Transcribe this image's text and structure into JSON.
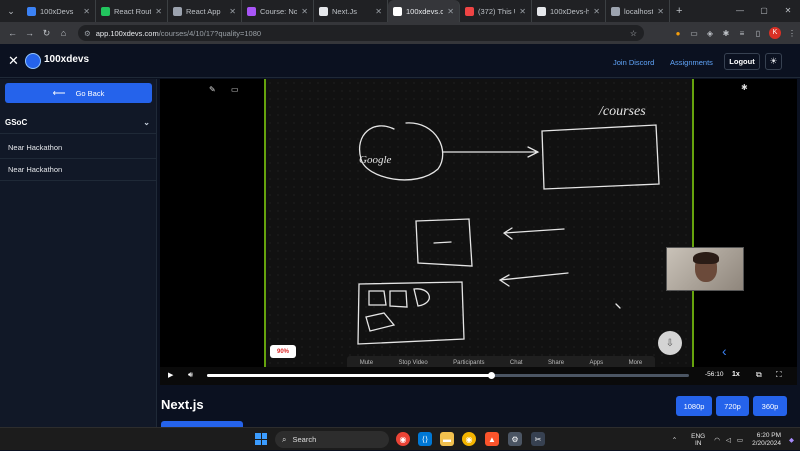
{
  "browser": {
    "tabs": [
      {
        "label": "100xDevs",
        "color": "#3b82f6"
      },
      {
        "label": "React Routin",
        "color": "#22c55e"
      },
      {
        "label": "React App",
        "color": "#9ca3af"
      },
      {
        "label": "Course: Node",
        "color": "#a855f7"
      },
      {
        "label": "Next.Js",
        "color": "#e5e7eb"
      },
      {
        "label": "100xdevs.co",
        "color": "#ffffff",
        "active": true
      },
      {
        "label": "(372) This U",
        "color": "#ef4444"
      },
      {
        "label": "100xDevs-hi",
        "color": "#e5e7eb"
      },
      {
        "label": "localhost",
        "color": "#9ca3af"
      }
    ],
    "url_host": "app.100xdevs.com",
    "url_path": "/courses/4/10/17?quality=1080",
    "profile_initial": "K"
  },
  "header": {
    "brand": "100xdevs",
    "join_discord": "Join Discord",
    "assignments": "Assignments",
    "logout": "Logout"
  },
  "sidebar": {
    "go_back": "Go Back",
    "section": "GSoC",
    "items": [
      "Near Hackathon",
      "Near Hackathon"
    ]
  },
  "player": {
    "whiteboard_text": "/courses",
    "bubble_text": "Google",
    "zoom_badge": "90%",
    "time_left": "-56:10",
    "speed": "1x",
    "progress": 0.59,
    "zoom_controls": [
      "Mute",
      "Stop Video",
      "Participants",
      "Chat",
      "Share",
      "Apps",
      "More"
    ]
  },
  "video": {
    "title": "Next.js",
    "qualities": [
      "1080p",
      "720p",
      "360p"
    ]
  },
  "taskbar": {
    "search": "Search",
    "lang_top": "ENG",
    "lang_bottom": "IN",
    "time": "6:20 PM",
    "date": "2/20/2024"
  }
}
